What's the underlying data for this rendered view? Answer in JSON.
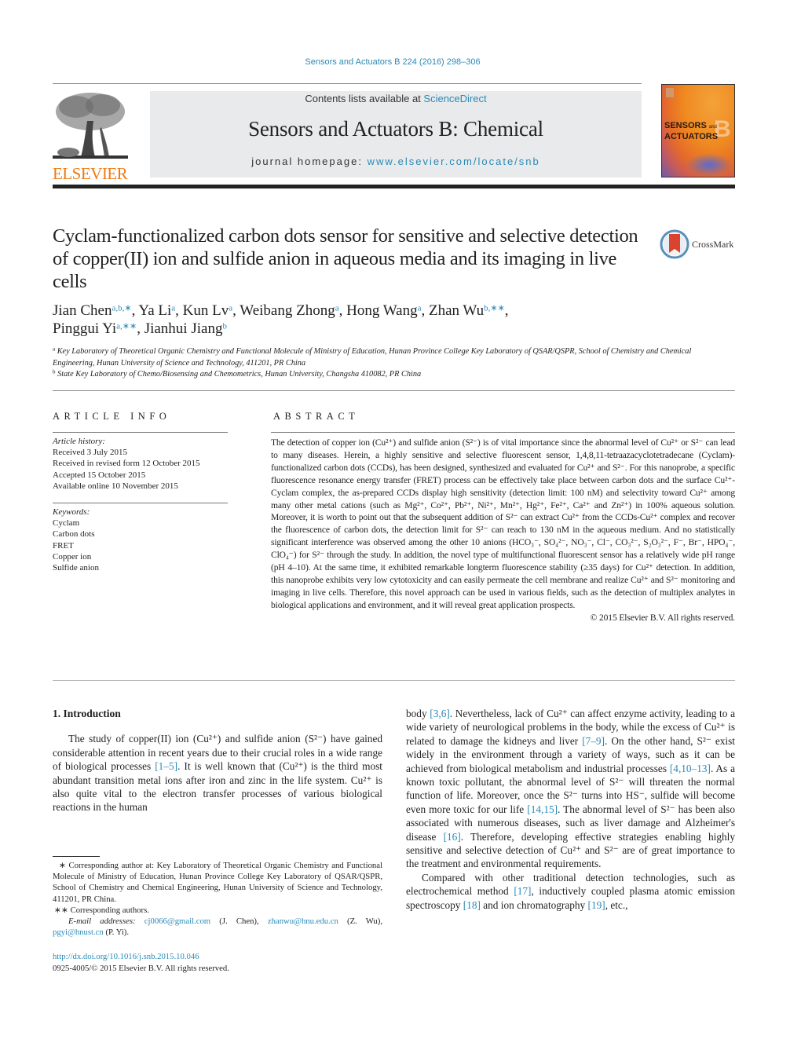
{
  "header": {
    "journal_ref": "Sensors and Actuators B 224 (2016) 298–306",
    "contents_prefix": "Contents lists available at ",
    "contents_link": "ScienceDirect",
    "journal_title": "Sensors and Actuators B: Chemical",
    "homepage_prefix": "journal homepage: ",
    "homepage_link": "www.elsevier.com/locate/snb",
    "publisher_logo": "ELSEVIER",
    "cover_line1": "SENSORS",
    "cover_and": "and",
    "cover_line2": "ACTUATORS",
    "cover_letter": "B",
    "crossmark_label": "CrossMark"
  },
  "article": {
    "title": "Cyclam-functionalized carbon dots sensor for sensitive and selective detection of copper(II) ion and sulfide anion in aqueous media and its imaging in live cells",
    "authors": [
      {
        "name": "Jian Chen",
        "sup": "a,b,∗",
        "sep": ", "
      },
      {
        "name": "Ya Li",
        "sup": "a",
        "sep": ", "
      },
      {
        "name": "Kun Lv",
        "sup": "a",
        "sep": ", "
      },
      {
        "name": "Weibang Zhong",
        "sup": "a",
        "sep": ", "
      },
      {
        "name": "Hong Wang",
        "sup": "a",
        "sep": ", "
      },
      {
        "name": "Zhan Wu",
        "sup": "b,∗∗",
        "sep": ","
      },
      {
        "name": "Pinggui Yi",
        "sup": "a,∗∗",
        "sep": ", "
      },
      {
        "name": "Jianhui Jiang",
        "sup": "b",
        "sep": ""
      }
    ],
    "affiliations": [
      {
        "mark": "a",
        "text": "Key Laboratory of Theoretical Organic Chemistry and Functional Molecule of Ministry of Education, Hunan Province College Key Laboratory of QSAR/QSPR, School of Chemistry and Chemical Engineering, Hunan University of Science and Technology, 411201, PR China"
      },
      {
        "mark": "b",
        "text": "State Key Laboratory of Chemo/Biosensing and Chemometrics, Hunan University, Changsha 410082, PR China"
      }
    ]
  },
  "article_info": {
    "heading": "ARTICLE INFO",
    "history_label": "Article history:",
    "history": [
      "Received 3 July 2015",
      "Received in revised form 12 October 2015",
      "Accepted 15 October 2015",
      "Available online 10 November 2015"
    ],
    "keywords_label": "Keywords:",
    "keywords": [
      "Cyclam",
      "Carbon dots",
      "FRET",
      "Copper ion",
      "Sulfide anion"
    ]
  },
  "abstract": {
    "heading": "ABSTRACT",
    "text": "The detection of copper ion (Cu²⁺) and sulfide anion (S²⁻) is of vital importance since the abnormal level of Cu²⁺ or S²⁻ can lead to many diseases. Herein, a highly sensitive and selective fluorescent sensor, 1,4,8,11-tetraazacyclotetradecane (Cyclam)-functionalized carbon dots (CCDs), has been designed, synthesized and evaluated for Cu²⁺ and S²⁻. For this nanoprobe, a specific fluorescence resonance energy transfer (FRET) process can be effectively take place between carbon dots and the surface Cu²⁺-Cyclam complex, the as-prepared CCDs display high sensitivity (detection limit: 100 nM) and selectivity toward Cu²⁺ among many other metal cations (such as Mg²⁺, Co²⁺, Pb²⁺, Ni²⁺, Mn²⁺, Hg²⁺, Fe²⁺, Ca²⁺ and Zn²⁺) in 100% aqueous solution. Moreover, it is worth to point out that the subsequent addition of S²⁻ can extract Cu²⁺ from the CCDs-Cu²⁺ complex and recover the fluorescence of carbon dots, the detection limit for S²⁻ can reach to 130 nM in the aqueous medium. And no statistically significant interference was observed among the other 10 anions (HCO₃⁻, SO₄²⁻, NO₃⁻, Cl⁻, CO₃²⁻, S₂O₃²⁻, F⁻, Br⁻, HPO₄⁻, ClO₄⁻) for S²⁻ through the study. In addition, the novel type of multifunctional fluorescent sensor has a relatively wide pH range (pH 4–10). At the same time, it exhibited remarkable longterm fluorescence stability (≥35 days) for Cu²⁺ detection. In addition, this nanoprobe exhibits very low cytotoxicity and can easily permeate the cell membrane and realize Cu²⁺ and S²⁻ monitoring and imaging in live cells. Therefore, this novel approach can be used in various fields, such as the detection of multiplex analytes in biological applications and environment, and it will reveal great application prospects.",
    "copyright": "© 2015 Elsevier B.V. All rights reserved."
  },
  "introduction": {
    "heading": "1.  Introduction",
    "left_paragraph": [
      {
        "t": "The study of copper(II) ion (Cu²⁺) and sulfide anion (S²⁻) have gained considerable attention in recent years due to their crucial roles in a wide range of biological processes "
      },
      {
        "ref": "[1–5]"
      },
      {
        "t": ". It is well known that (Cu²⁺) is the third most abundant transition metal ions after iron and zinc in the life system. Cu²⁺ is also quite vital to the electron transfer processes of various biological reactions in the human"
      }
    ],
    "right_paragraph1": [
      {
        "t": "body "
      },
      {
        "ref": "[3,6]"
      },
      {
        "t": ". Nevertheless, lack of Cu²⁺ can affect enzyme activity, leading to a wide variety of neurological problems in the body, while the excess of Cu²⁺ is related to damage the kidneys and liver "
      },
      {
        "ref": "[7–9]"
      },
      {
        "t": ". On the other hand, S²⁻ exist widely in the environment through a variety of ways, such as it can be achieved from biological metabolism and industrial processes "
      },
      {
        "ref": "[4,10–13]"
      },
      {
        "t": ". As a known toxic pollutant, the abnormal level of S²⁻ will threaten the normal function of life. Moreover, once the S²⁻ turns into HS⁻, sulfide will become even more toxic for our life "
      },
      {
        "ref": "[14,15]"
      },
      {
        "t": ". The abnormal level of S²⁻ has been also associated with numerous diseases, such as liver damage and Alzheimer's disease "
      },
      {
        "ref": "[16]"
      },
      {
        "t": ". Therefore, developing effective strategies enabling highly sensitive and selective detection of Cu²⁺ and S²⁻ are of great importance to the treatment and environmental requirements."
      }
    ],
    "right_paragraph2": [
      {
        "t": "Compared with other traditional detection technologies, such as electrochemical method "
      },
      {
        "ref": "[17]"
      },
      {
        "t": ", inductively coupled plasma atomic emission spectroscopy "
      },
      {
        "ref": "[18]"
      },
      {
        "t": " and ion chromatography "
      },
      {
        "ref": "[19]"
      },
      {
        "t": ", etc.,"
      }
    ]
  },
  "footnotes": {
    "corresponding1": "∗  Corresponding author at: Key Laboratory of Theoretical Organic Chemistry and Functional Molecule of Ministry of Education, Hunan Province College Key Laboratory of QSAR/QSPR, School of Chemistry and Chemical Engineering, Hunan University of Science and Technology, 411201, PR China.",
    "corresponding2": "∗∗  Corresponding authors.",
    "email_label": "E-mail addresses: ",
    "emails": [
      {
        "addr": "cj0066@gmail.com",
        "who": " (J. Chen), "
      },
      {
        "addr": "zhanwu@hnu.edu.cn",
        "who": " (Z. Wu), "
      },
      {
        "addr": "pgyi@hnust.cn",
        "who": " (P. Yi)."
      }
    ],
    "doi": "http://dx.doi.org/10.1016/j.snb.2015.10.046",
    "issn_copyright": "0925-4005/© 2015 Elsevier B.V. All rights reserved."
  },
  "colors": {
    "link": "#2a8ab8",
    "elsevier_orange": "#f07a12",
    "masthead_bg": "#e9eaeb"
  }
}
